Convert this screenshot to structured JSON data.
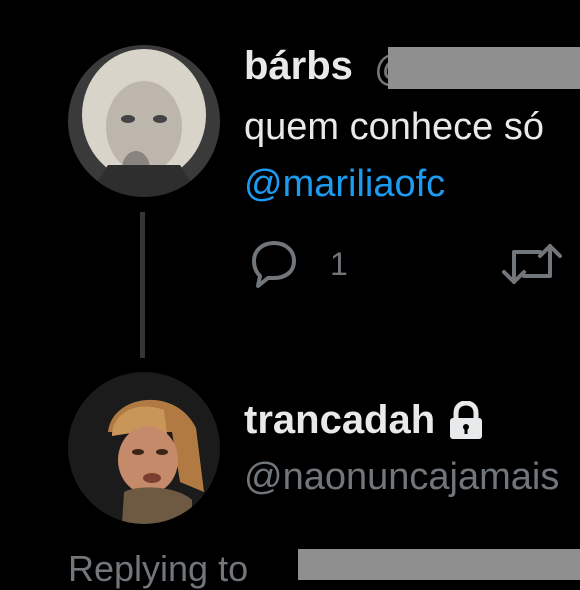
{
  "tweet": {
    "author_name": "bárbs",
    "handle_prefix": "@",
    "text": "quem conhece só",
    "mention": "@mariliaofc",
    "reply_count": "1"
  },
  "reply": {
    "author_name": "trancadah",
    "handle": "@naonuncajamais",
    "replying_label": "Replying to"
  },
  "icons": {
    "reply": "reply-icon",
    "retweet": "retweet-icon",
    "lock": "lock-icon"
  },
  "colors": {
    "background": "#000000",
    "text": "#e7e9ea",
    "muted": "#71767b",
    "link": "#1d9bf0",
    "redaction": "#8f8f8f"
  }
}
